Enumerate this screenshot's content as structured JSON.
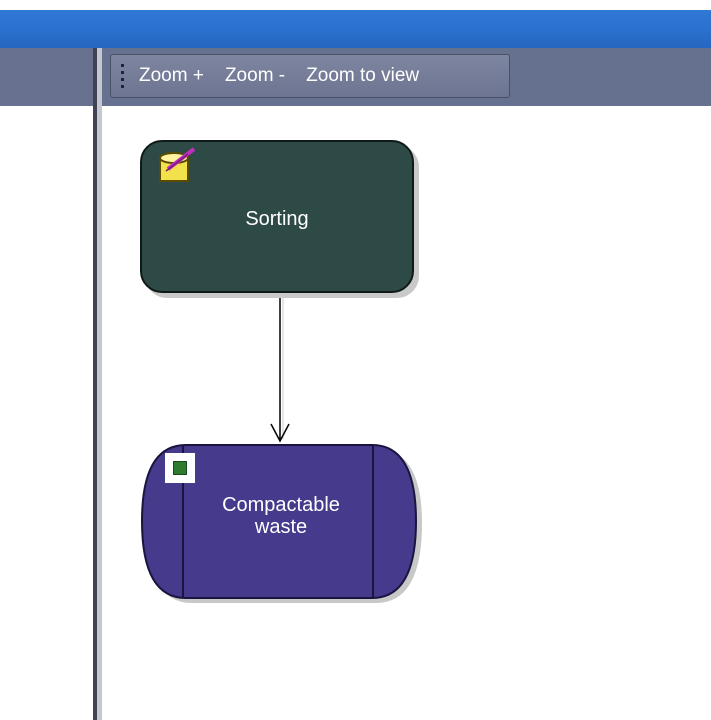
{
  "toolbar": {
    "zoom_in_label": "Zoom +",
    "zoom_out_label": "Zoom -",
    "zoom_to_view_label": "Zoom to view"
  },
  "diagram": {
    "nodes": [
      {
        "id": "sorting",
        "label": "Sorting",
        "color": "#2e4a47",
        "icon": "sorting-bin-icon"
      },
      {
        "id": "waste",
        "label_line1": "Compactable",
        "label_line2": "waste",
        "color": "#453a8c",
        "icon": "green-square-icon"
      }
    ],
    "edges": [
      {
        "from": "sorting",
        "to": "waste"
      }
    ]
  },
  "colors": {
    "title_bar": "#2a6fcc",
    "toolbar_bg": "#6d7592"
  }
}
